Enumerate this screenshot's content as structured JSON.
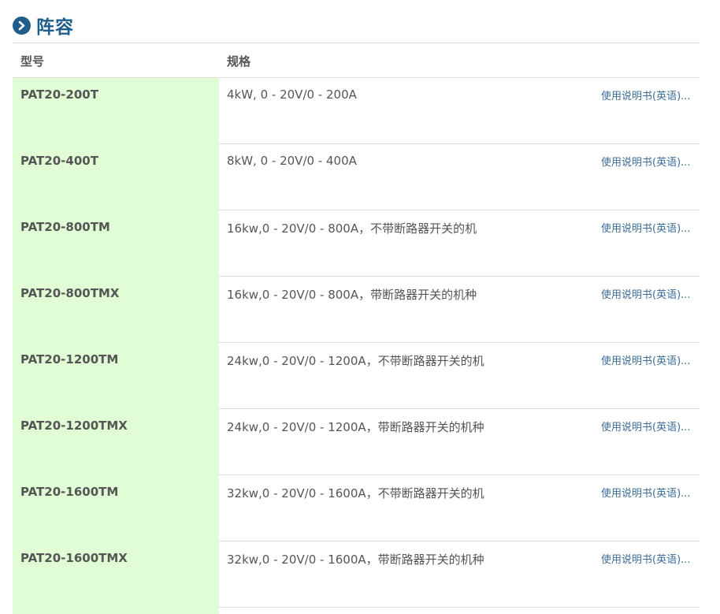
{
  "section": {
    "title": "阵容",
    "icon": "chevron-right-circle-icon",
    "accent_color": "#1f5e8a"
  },
  "table": {
    "columns": {
      "model": "型号",
      "spec": "规格"
    },
    "model_column_bg": "#e0fdd5",
    "link_color": "#3c6d96",
    "rows": [
      {
        "model": "PAT20-200T",
        "spec": "4kW, 0 - 20V/0 - 200A",
        "manual": "使用说明书(英语)..."
      },
      {
        "model": "PAT20-400T",
        "spec": "8kW, 0 - 20V/0 - 400A",
        "manual": "使用说明书(英语)..."
      },
      {
        "model": "PAT20-800TM",
        "spec": "16kw,0 - 20V/0 - 800A，不带断路器开关的机",
        "manual": "使用说明书(英语)..."
      },
      {
        "model": "PAT20-800TMX",
        "spec": "16kw,0 - 20V/0 - 800A，带断路器开关的机种",
        "manual": "使用说明书(英语)..."
      },
      {
        "model": "PAT20-1200TM",
        "spec": "24kw,0 - 20V/0 - 1200A，不带断路器开关的机",
        "manual": "使用说明书(英语)..."
      },
      {
        "model": "PAT20-1200TMX",
        "spec": "24kw,0 - 20V/0 - 1200A，带断路器开关的机种",
        "manual": "使用说明书(英语)..."
      },
      {
        "model": "PAT20-1600TM",
        "spec": "32kw,0 - 20V/0 - 1600A，不带断路器开关的机",
        "manual": "使用说明书(英语)..."
      },
      {
        "model": "PAT20-1600TMX",
        "spec": "32kw,0 - 20V/0 - 1600A，带断路器开关的机种",
        "manual": "使用说明书(英语)..."
      }
    ]
  }
}
